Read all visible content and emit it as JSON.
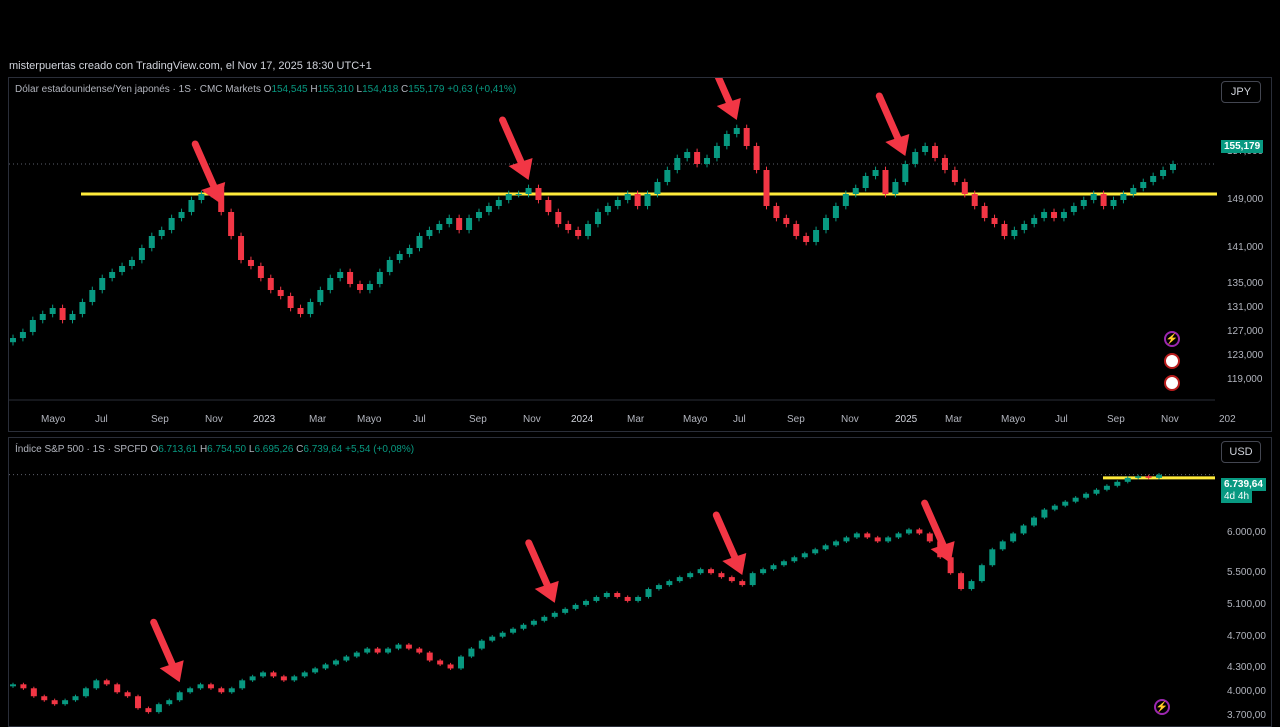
{
  "credit": "misterpuertas creado con TradingView.com, el Nov 17, 2025 18:30 UTC+1",
  "colors": {
    "up": "#089981",
    "down": "#f23645",
    "level": "#ffeb3b",
    "arrow": "#f23645",
    "bg": "#000000"
  },
  "chart_data": [
    {
      "type": "candlestick",
      "symbol_line": "Dólar estadounidense/Yen japonés · 1S · CMC Markets",
      "ohlc": {
        "o_label": "O",
        "o": "154,545",
        "h_label": "H",
        "h": "155,310",
        "l_label": "L",
        "l": "154,418",
        "c_label": "C",
        "c": "155,179",
        "change": "+0,63 (+0,41%)"
      },
      "currency": "JPY",
      "last_price": "155,179",
      "y_ticks": [
        "157,000",
        "149,000",
        "141,000",
        "135,000",
        "131,000",
        "127,000",
        "123,000",
        "119,000"
      ],
      "y_tick_values": [
        157,
        149,
        141,
        135,
        131,
        127,
        123,
        119
      ],
      "x_ticks": [
        "Mayo",
        "Jul",
        "Sep",
        "Nov",
        "2023",
        "Mar",
        "Mayo",
        "Jul",
        "Sep",
        "Nov",
        "2024",
        "Mar",
        "Mayo",
        "Jul",
        "Sep",
        "Nov",
        "2025",
        "Mar",
        "Mayo",
        "Jul",
        "Sep",
        "Nov",
        "202"
      ],
      "level": 150.0,
      "close_series": [
        126,
        127,
        129,
        130,
        131,
        129,
        130,
        132,
        134,
        136,
        137,
        138,
        139,
        141,
        143,
        144,
        146,
        147,
        149,
        150,
        151,
        147,
        143,
        139,
        138,
        136,
        134,
        133,
        131,
        130,
        132,
        134,
        136,
        137,
        135,
        134,
        135,
        137,
        139,
        140,
        141,
        143,
        144,
        145,
        146,
        144,
        146,
        147,
        148,
        149,
        150,
        150,
        151,
        149,
        147,
        145,
        144,
        143,
        145,
        147,
        148,
        149,
        150,
        148,
        150,
        152,
        154,
        156,
        157,
        155,
        156,
        158,
        160,
        161,
        158,
        154,
        148,
        146,
        145,
        143,
        142,
        144,
        146,
        148,
        150,
        151,
        153,
        154,
        150,
        152,
        155,
        157,
        158,
        156,
        154,
        152,
        150,
        148,
        146,
        145,
        143,
        144,
        145,
        146,
        147,
        146,
        147,
        148,
        149,
        150,
        148,
        149,
        150,
        151,
        152,
        153,
        154,
        155
      ],
      "arrows_at": [
        21,
        52,
        73,
        90
      ]
    },
    {
      "type": "candlestick",
      "symbol_line": "Índice S&P 500 · 1S · SPCFD",
      "ohlc": {
        "o_label": "O",
        "o": "6.713,61",
        "h_label": "H",
        "h": "6.754,50",
        "l_label": "L",
        "l": "6.695,26",
        "c_label": "C",
        "c": "6.739,64",
        "change": "+5,54 (+0,08%)"
      },
      "currency": "USD",
      "last_price": "6.739,64",
      "countdown": "4d 4h",
      "y_ticks": [
        "6.000,00",
        "5.500,00",
        "5.100,00",
        "4.700,00",
        "4.300,00",
        "4.000,00",
        "3.700,00"
      ],
      "y_tick_values": [
        6000,
        5500,
        5100,
        4700,
        4300,
        4000,
        3700
      ],
      "level": 6700,
      "close_series": [
        4100,
        4050,
        3950,
        3900,
        3850,
        3900,
        3950,
        4050,
        4150,
        4100,
        4000,
        3950,
        3800,
        3750,
        3850,
        3900,
        4000,
        4050,
        4100,
        4050,
        4000,
        4050,
        4150,
        4200,
        4250,
        4200,
        4150,
        4200,
        4250,
        4300,
        4350,
        4400,
        4450,
        4500,
        4550,
        4500,
        4550,
        4600,
        4550,
        4500,
        4400,
        4350,
        4300,
        4450,
        4550,
        4650,
        4700,
        4750,
        4800,
        4850,
        4900,
        4950,
        5000,
        5050,
        5100,
        5150,
        5200,
        5250,
        5200,
        5150,
        5200,
        5300,
        5350,
        5400,
        5450,
        5500,
        5550,
        5500,
        5450,
        5400,
        5350,
        5500,
        5550,
        5600,
        5650,
        5700,
        5750,
        5800,
        5850,
        5900,
        5950,
        6000,
        5950,
        5900,
        5950,
        6000,
        6050,
        6000,
        5900,
        5700,
        5500,
        5300,
        5400,
        5600,
        5800,
        5900,
        6000,
        6100,
        6200,
        6300,
        6350,
        6400,
        6450,
        6500,
        6550,
        6600,
        6650,
        6700,
        6720,
        6700,
        6740
      ],
      "arrows_at": [
        16,
        52,
        70,
        90
      ]
    }
  ]
}
